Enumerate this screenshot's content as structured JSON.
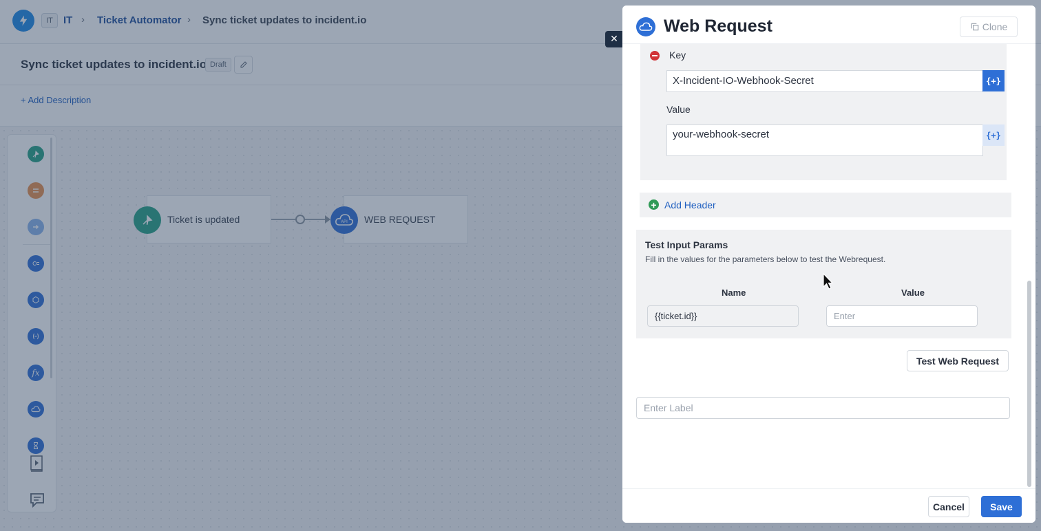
{
  "breadcrumb": {
    "workspace_badge": "IT",
    "workspace": "IT",
    "module": "Ticket Automator",
    "current": "Sync ticket updates to incident.io"
  },
  "page": {
    "title": "Sync ticket updates to incident.io",
    "status": "Draft",
    "add_description": "+ Add Description"
  },
  "workflow": {
    "trigger_label": "Ticket is updated",
    "action_label": "WEB REQUEST",
    "action_icon_text": "API"
  },
  "palette": {
    "icons": [
      "trigger-icon",
      "condition-icon",
      "arrow-icon",
      "query-icon",
      "app-icon",
      "variable-icon",
      "function-icon",
      "webrequest-icon",
      "timer-icon",
      "video-guide-icon",
      "chat-icon"
    ],
    "function_glyph": "fx"
  },
  "drawer": {
    "title": "Web Request",
    "clone_label": "Clone",
    "close_glyph": "✕",
    "header": {
      "key_label": "Key",
      "key_value": "X-Incident-IO-Webhook-Secret",
      "value_label": "Value",
      "value_value": "your-webhook-secret",
      "var_button": "{+}"
    },
    "add_header_label": "Add Header",
    "test": {
      "title": "Test Input Params",
      "description": "Fill in the values for the parameters below to test the Webrequest.",
      "col_name": "Name",
      "col_value": "Value",
      "param_name": "{{ticket.id}}",
      "param_value_placeholder": "Enter"
    },
    "test_button": "Test Web Request",
    "label_placeholder": "Enter Label",
    "cancel_label": "Cancel",
    "save_label": "Save"
  },
  "colors": {
    "accent": "#2e6fd6",
    "link": "#1f5fc0",
    "trigger_green": "#27a085",
    "danger": "#d13438",
    "success": "#2f9a56"
  }
}
